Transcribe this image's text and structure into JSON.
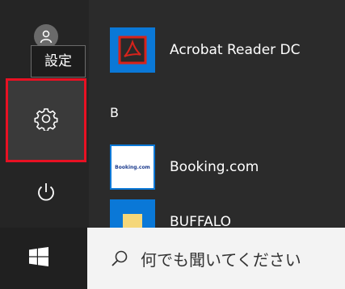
{
  "rail": {
    "tooltip": "設定"
  },
  "apps": {
    "section_letter": "B",
    "items": [
      {
        "label": "Acrobat Reader DC",
        "icon": "acrobat-icon"
      },
      {
        "label": "Booking.com",
        "icon": "booking-icon",
        "tile_text": "Booking.com"
      },
      {
        "label": "BUFFALO",
        "icon": "folder-icon"
      }
    ]
  },
  "taskbar": {
    "search_placeholder": "何でも聞いてください"
  },
  "colors": {
    "highlight": "#e81123",
    "tile": "#0a78d7",
    "acrobat_red": "#d7231b",
    "booking_blue": "#1e3d8f"
  }
}
